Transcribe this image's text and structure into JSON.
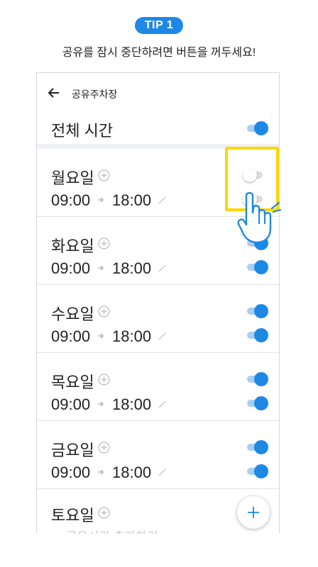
{
  "tip": {
    "badge": "TIP 1",
    "text": "공유를 잠시 중단하려면 버튼을 꺼두세요!"
  },
  "appbar": {
    "title": "공유주차장"
  },
  "all_time": {
    "label": "전체 시간",
    "enabled": true
  },
  "days": [
    {
      "name": "월요일",
      "start": "09:00",
      "end": "18:00",
      "day_enabled": false,
      "time_enabled": false
    },
    {
      "name": "화요일",
      "start": "09:00",
      "end": "18:00",
      "day_enabled": true,
      "time_enabled": true
    },
    {
      "name": "수요일",
      "start": "09:00",
      "end": "18:00",
      "day_enabled": true,
      "time_enabled": true
    },
    {
      "name": "목요일",
      "start": "09:00",
      "end": "18:00",
      "day_enabled": true,
      "time_enabled": true
    },
    {
      "name": "금요일",
      "start": "09:00",
      "end": "18:00",
      "day_enabled": true,
      "time_enabled": true
    },
    {
      "name": "토요일"
    }
  ],
  "add_time_link": "+ 공유시간 추가하기",
  "colors": {
    "accent": "#1e88e5",
    "highlight": "#ffd600"
  }
}
